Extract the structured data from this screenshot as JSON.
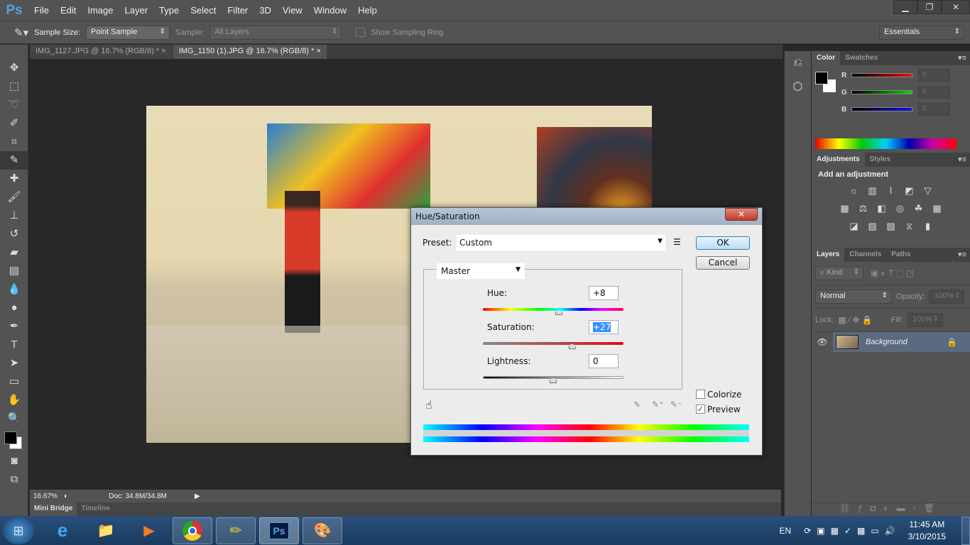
{
  "app": {
    "logo": "Ps",
    "menus": [
      "File",
      "Edit",
      "Image",
      "Layer",
      "Type",
      "Select",
      "Filter",
      "3D",
      "View",
      "Window",
      "Help"
    ],
    "window_controls": [
      "minimize",
      "restore",
      "close"
    ]
  },
  "options": {
    "sample_size_label": "Sample Size:",
    "sample_size_value": "Point Sample",
    "sample_label": "Sample:",
    "sample_value": "All Layers",
    "sampling_ring_label": "Show Sampling Ring",
    "workspace": "Essentials"
  },
  "tabs": [
    {
      "label": "IMG_1127.JPG @ 16.7% (RGB/8) *",
      "active": false
    },
    {
      "label": "IMG_1150 (1).JPG @ 16.7% (RGB/8) *",
      "active": true
    }
  ],
  "tools": [
    "move",
    "marquee",
    "lasso",
    "quick-select",
    "crop",
    "eyedropper",
    "healing",
    "brush",
    "stamp",
    "history-brush",
    "eraser",
    "gradient",
    "blur",
    "dodge",
    "pen",
    "type",
    "path-select",
    "shape",
    "hand",
    "zoom"
  ],
  "status": {
    "zoom": "16.67%",
    "doc": "Doc: 34.8M/34.8M"
  },
  "bottom_tabs": [
    "Mini Bridge",
    "Timeline"
  ],
  "color_panel": {
    "tabs": [
      "Color",
      "Swatches"
    ],
    "channels": [
      {
        "label": "R",
        "value": "0",
        "color": "#e01010"
      },
      {
        "label": "G",
        "value": "0",
        "color": "#10d010"
      },
      {
        "label": "B",
        "value": "0",
        "color": "#1010e0"
      }
    ]
  },
  "adjustments_panel": {
    "tabs": [
      "Adjustments",
      "Styles"
    ],
    "heading": "Add an adjustment"
  },
  "layers_panel": {
    "tabs": [
      "Layers",
      "Channels",
      "Paths"
    ],
    "filter": "Kind",
    "blend_mode": "Normal",
    "opacity_label": "Opacity:",
    "opacity": "100%",
    "lock_label": "Lock:",
    "fill_label": "Fill:",
    "fill": "100%",
    "layers": [
      {
        "name": "Background",
        "visible": true,
        "locked": true
      }
    ]
  },
  "dialog": {
    "title": "Hue/Saturation",
    "preset_label": "Preset:",
    "preset_value": "Custom",
    "channel": "Master",
    "ok": "OK",
    "cancel": "Cancel",
    "hue_label": "Hue:",
    "hue": "+8",
    "hue_pos": 0.54,
    "saturation_label": "Saturation:",
    "saturation": "+27",
    "saturation_pos": 0.635,
    "lightness_label": "Lightness:",
    "lightness": "0",
    "lightness_pos": 0.5,
    "colorize_label": "Colorize",
    "colorize": false,
    "preview_label": "Preview",
    "preview": true
  },
  "taskbar": {
    "apps": [
      "Internet Explorer",
      "File Explorer",
      "Media Player",
      "Chrome",
      "Sketch tool",
      "Photoshop",
      "Paint"
    ],
    "lang": "EN",
    "time": "11:45 AM",
    "date": "3/10/2015"
  }
}
